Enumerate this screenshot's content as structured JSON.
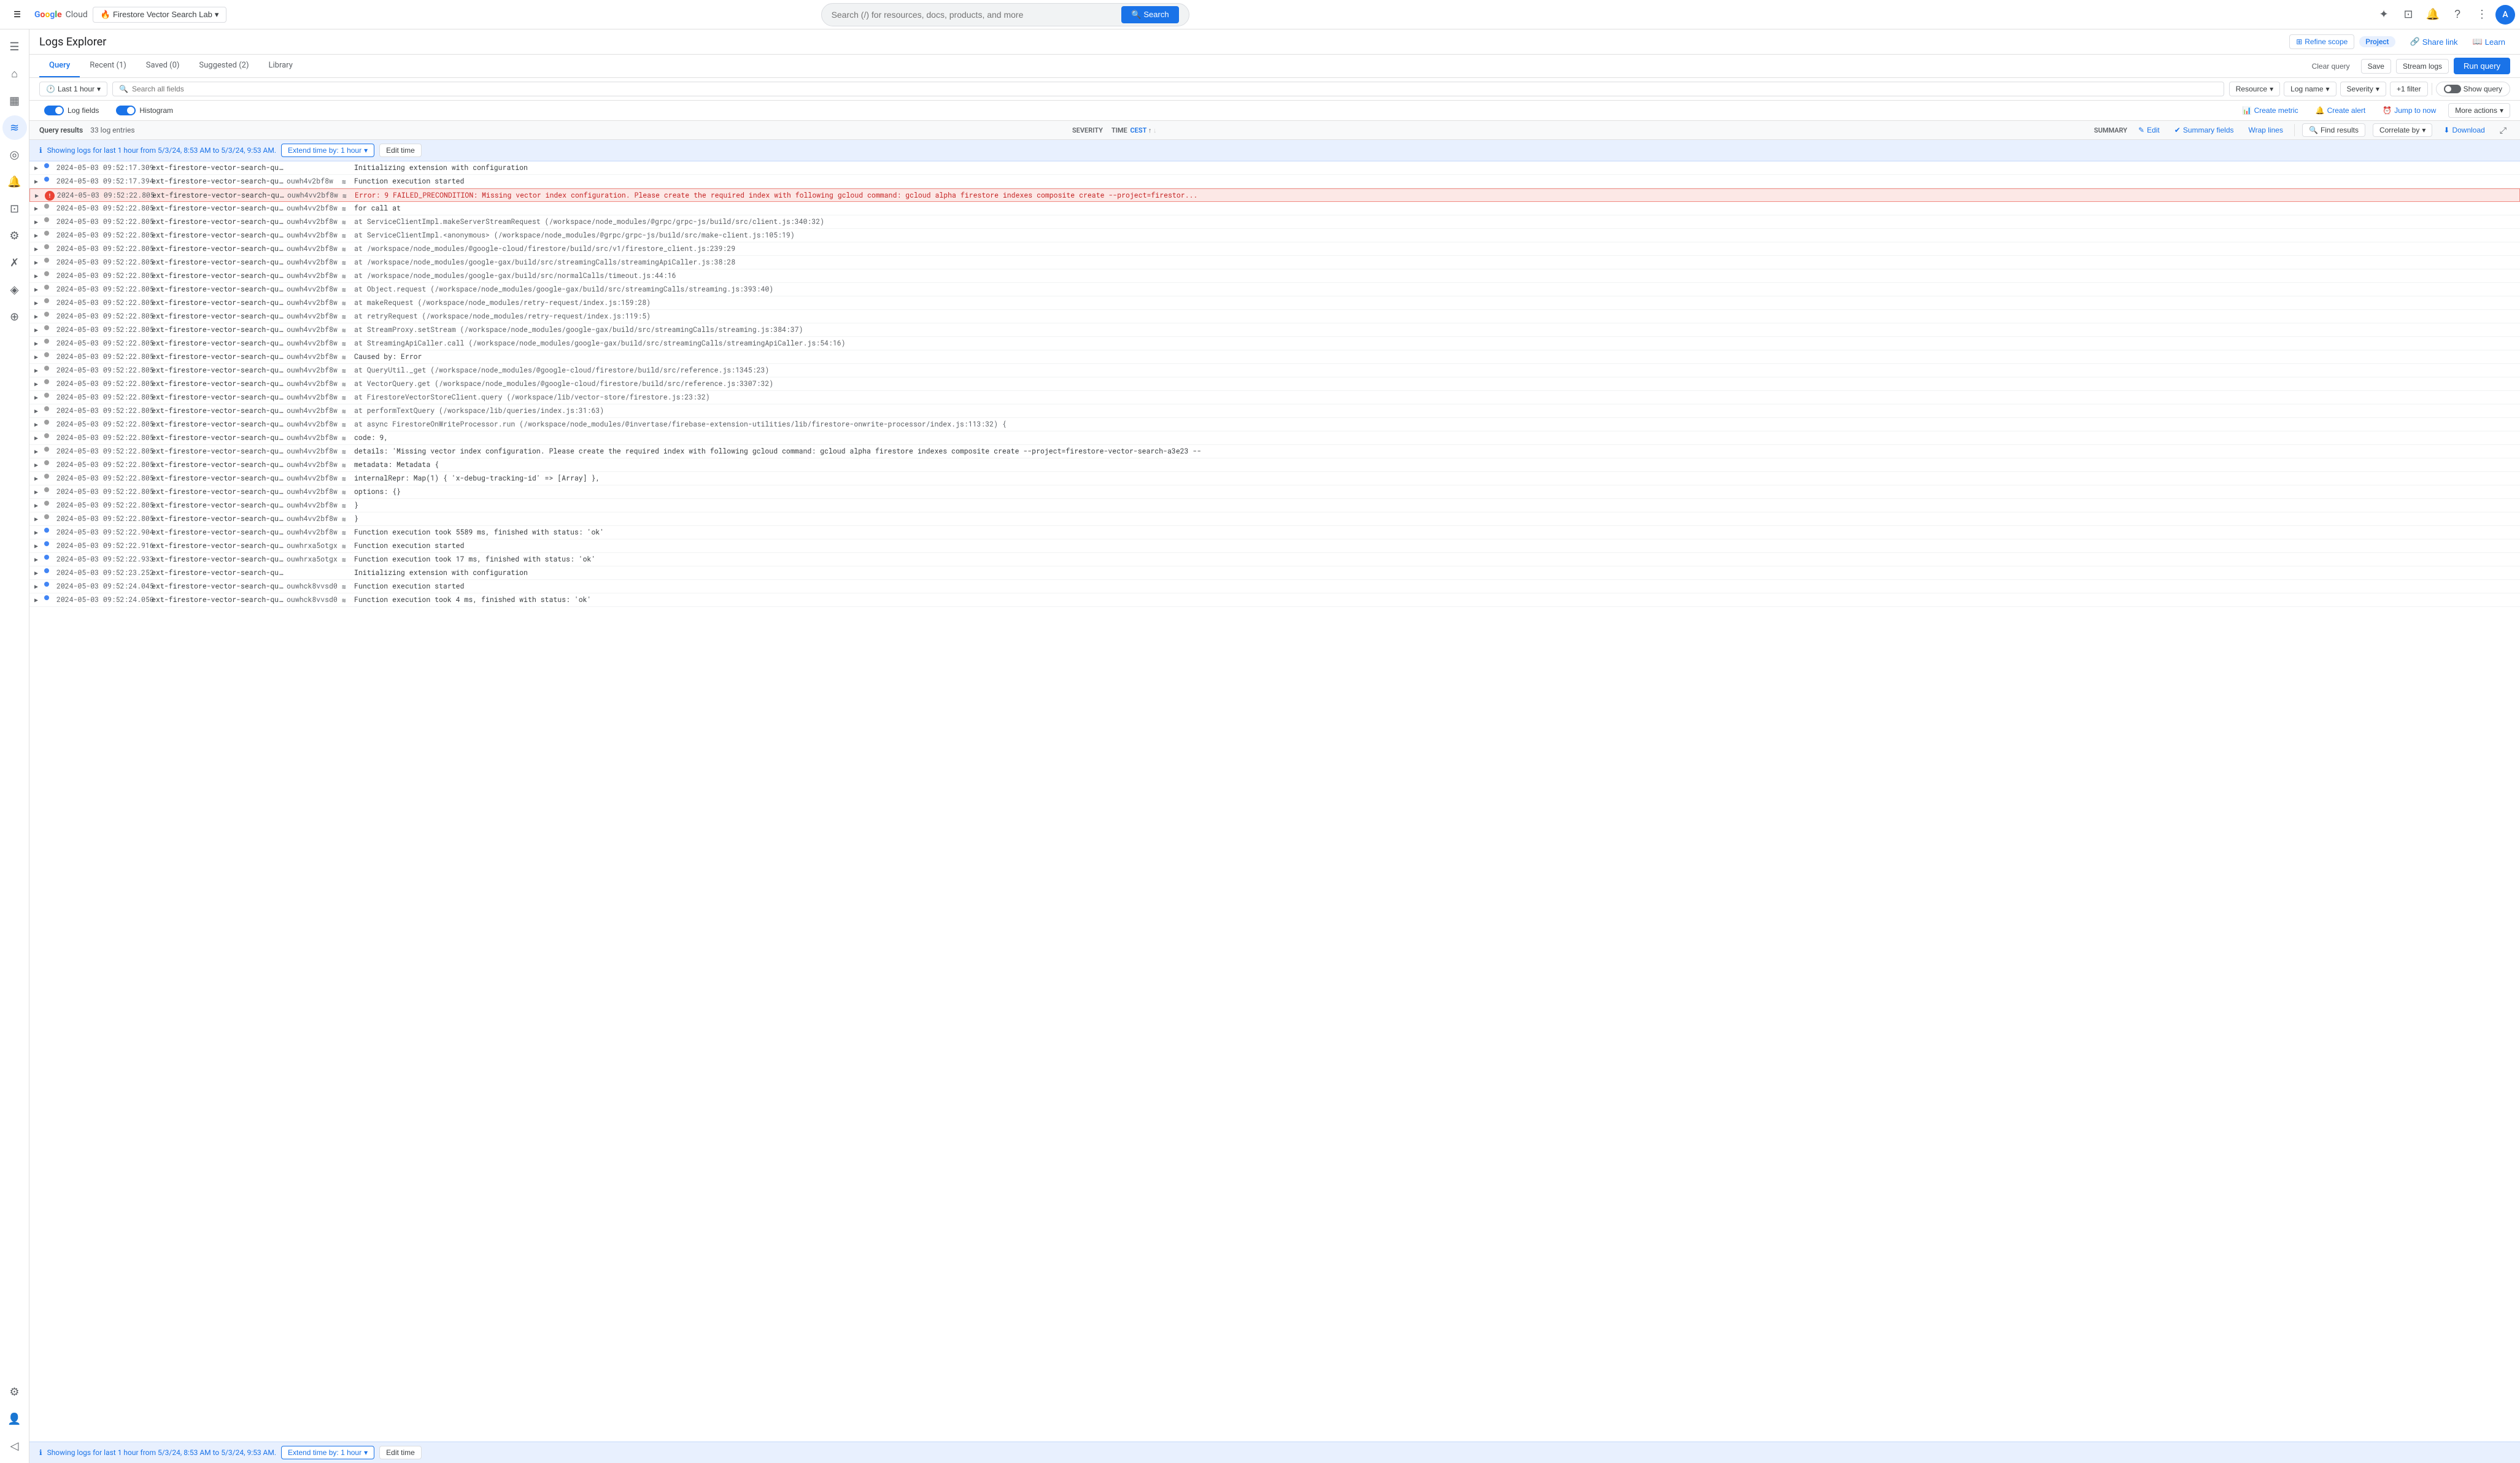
{
  "topNav": {
    "hamburger": "☰",
    "logoLetters": [
      "G",
      "o",
      "o",
      "g",
      "l",
      "e"
    ],
    "logoColors": [
      "#4285f4",
      "#ea4335",
      "#fbbc04",
      "#4285f4",
      "#34a853",
      "#ea4335"
    ],
    "cloudText": " Cloud",
    "projectSelector": "Firestore Vector Search Lab",
    "searchPlaceholder": "Search (/) for resources, docs, products, and more",
    "searchBtn": "Search",
    "navIcons": [
      "✦",
      "⊡",
      "🔔",
      "?",
      "⋮"
    ],
    "avatarInitial": "A"
  },
  "sidebar": {
    "icons": [
      "≡",
      "○",
      "▦",
      "≋",
      "◎",
      "🔔",
      "⊡",
      "⚙",
      "⚙",
      "👤"
    ]
  },
  "pageHeader": {
    "title": "Logs Explorer",
    "refineScopeLabel": "Refine scope",
    "projectBadge": "Project",
    "shareLink": "Share link",
    "learn": "Learn"
  },
  "tabs": {
    "items": [
      {
        "label": "Query",
        "active": true
      },
      {
        "label": "Recent (1)",
        "active": false
      },
      {
        "label": "Saved (0)",
        "active": false
      },
      {
        "label": "Suggested (2)",
        "active": false
      },
      {
        "label": "Library",
        "active": false
      }
    ],
    "clearQuery": "Clear query",
    "save": "Save",
    "streamLogs": "Stream logs",
    "runQuery": "Run query"
  },
  "queryToolbar": {
    "timeLabel": "Last 1 hour",
    "searchPlaceholder": "Search all fields",
    "resourceLabel": "Resource",
    "logNameLabel": "Log name",
    "severityLabel": "Severity",
    "plusFilter": "+1 filter",
    "showQuery": "Show query"
  },
  "logToolbar": {
    "logFieldsLabel": "Log fields",
    "histogramLabel": "Histogram",
    "createMetric": "Create metric",
    "createAlert": "Create alert",
    "jumpNow": "Jump to now",
    "moreActions": "More actions"
  },
  "resultsBar": {
    "count": "Query results",
    "entries": "33 log entries",
    "severityLabel": "SEVERITY",
    "timeLabel": "TIME",
    "timeSort": "CEST",
    "summaryLabel": "SUMMARY",
    "editLabel": "✎ Edit",
    "summaryFieldsLabel": "✔ Summary fields",
    "wrapLines": "Wrap lines",
    "findResults": "Find results",
    "correlateBy": "Correlate by",
    "download": "Download",
    "expand": "⤢"
  },
  "infoBanner": {
    "icon": "ℹ",
    "text": "Showing logs for last 1 hour from 5/3/24, 8:53 AM to 5/3/24, 9:53 AM.",
    "extendBtn": "Extend time by: 1 hour",
    "extendDropdown": "▾",
    "editTime": "Edit time"
  },
  "logEntries": [
    {
      "expand": "▶",
      "severity": "info",
      "time": "2024-05-03  09:52:17.309",
      "function": "ext-firestore-vector-search-queryOnWrite",
      "id": "",
      "hasIcon": false,
      "message": "Initializing extension with configuration"
    },
    {
      "expand": "▶",
      "severity": "info",
      "time": "2024-05-03  09:52:17.394",
      "function": "ext-firestore-vector-search-queryOnWrite",
      "id": "ouwh4v2bf8w",
      "hasIcon": true,
      "message": "Function execution started"
    },
    {
      "expand": "▶",
      "severity": "error",
      "time": "2024-05-03  09:52:22.805",
      "function": "ext-firestore-vector-search-queryOnWrite",
      "id": "ouwh4vv2bf8w",
      "hasIcon": true,
      "message": "Error: 9 FAILED_PRECONDITION: Missing vector index configuration. Please create the required index with following gcloud command: gcloud alpha firestore indexes composite create --project=firestor...",
      "isErrorHighlight": true
    },
    {
      "expand": "▶",
      "severity": "debug",
      "time": "2024-05-03  09:52:22.805",
      "function": "ext-firestore-vector-search-queryOnWrite",
      "id": "ouwh4vv2bf8w",
      "hasIcon": true,
      "message": "for call at"
    },
    {
      "expand": "▶",
      "severity": "debug",
      "time": "2024-05-03  09:52:22.805",
      "function": "ext-firestore-vector-search-queryOnWrite",
      "id": "ouwh4vv2bf8w",
      "hasIcon": true,
      "message": "    at ServiceClientImpl.makeServerStreamRequest (/workspace/node_modules/@grpc/grpc-js/build/src/client.js:340:32)"
    },
    {
      "expand": "▶",
      "severity": "debug",
      "time": "2024-05-03  09:52:22.805",
      "function": "ext-firestore-vector-search-queryOnWrite",
      "id": "ouwh4vv2bf8w",
      "hasIcon": true,
      "message": "    at ServiceClientImpl.<anonymous> (/workspace/node_modules/@grpc/grpc-js/build/src/make-client.js:105:19)"
    },
    {
      "expand": "▶",
      "severity": "debug",
      "time": "2024-05-03  09:52:22.805",
      "function": "ext-firestore-vector-search-queryOnWrite",
      "id": "ouwh4vv2bf8w",
      "hasIcon": true,
      "message": "    at /workspace/node_modules/@google-cloud/firestore/build/src/v1/firestore_client.js:239:29"
    },
    {
      "expand": "▶",
      "severity": "debug",
      "time": "2024-05-03  09:52:22.805",
      "function": "ext-firestore-vector-search-queryOnWrite",
      "id": "ouwh4vv2bf8w",
      "hasIcon": true,
      "message": "    at /workspace/node_modules/google-gax/build/src/streamingCalls/streamingApiCaller.js:38:28"
    },
    {
      "expand": "▶",
      "severity": "debug",
      "time": "2024-05-03  09:52:22.805",
      "function": "ext-firestore-vector-search-queryOnWrite",
      "id": "ouwh4vv2bf8w",
      "hasIcon": true,
      "message": "    at /workspace/node_modules/google-gax/build/src/normalCalls/timeout.js:44:16"
    },
    {
      "expand": "▶",
      "severity": "debug",
      "time": "2024-05-03  09:52:22.805",
      "function": "ext-firestore-vector-search-queryOnWrite",
      "id": "ouwh4vv2bf8w",
      "hasIcon": true,
      "message": "    at Object.request (/workspace/node_modules/google-gax/build/src/streamingCalls/streaming.js:393:40)"
    },
    {
      "expand": "▶",
      "severity": "debug",
      "time": "2024-05-03  09:52:22.805",
      "function": "ext-firestore-vector-search-queryOnWrite",
      "id": "ouwh4vv2bf8w",
      "hasIcon": true,
      "message": "    at makeRequest (/workspace/node_modules/retry-request/index.js:159:28)"
    },
    {
      "expand": "▶",
      "severity": "debug",
      "time": "2024-05-03  09:52:22.805",
      "function": "ext-firestore-vector-search-queryOnWrite",
      "id": "ouwh4vv2bf8w",
      "hasIcon": true,
      "message": "    at retryRequest (/workspace/node_modules/retry-request/index.js:119:5)"
    },
    {
      "expand": "▶",
      "severity": "debug",
      "time": "2024-05-03  09:52:22.805",
      "function": "ext-firestore-vector-search-queryOnWrite",
      "id": "ouwh4vv2bf8w",
      "hasIcon": true,
      "message": "    at StreamProxy.setStream (/workspace/node_modules/google-gax/build/src/streamingCalls/streaming.js:384:37)"
    },
    {
      "expand": "▶",
      "severity": "debug",
      "time": "2024-05-03  09:52:22.805",
      "function": "ext-firestore-vector-search-queryOnWrite",
      "id": "ouwh4vv2bf8w",
      "hasIcon": true,
      "message": "    at StreamingApiCaller.call (/workspace/node_modules/google-gax/build/src/streamingCalls/streamingApiCaller.js:54:16)"
    },
    {
      "expand": "▶",
      "severity": "debug",
      "time": "2024-05-03  09:52:22.805",
      "function": "ext-firestore-vector-search-queryOnWrite",
      "id": "ouwh4vv2bf8w",
      "hasIcon": true,
      "message": "Caused by: Error"
    },
    {
      "expand": "▶",
      "severity": "debug",
      "time": "2024-05-03  09:52:22.805",
      "function": "ext-firestore-vector-search-queryOnWrite",
      "id": "ouwh4vv2bf8w",
      "hasIcon": true,
      "message": "    at QueryUtil._get (/workspace/node_modules/@google-cloud/firestore/build/src/reference.js:1345:23)"
    },
    {
      "expand": "▶",
      "severity": "debug",
      "time": "2024-05-03  09:52:22.805",
      "function": "ext-firestore-vector-search-queryOnWrite",
      "id": "ouwh4vv2bf8w",
      "hasIcon": true,
      "message": "    at VectorQuery.get (/workspace/node_modules/@google-cloud/firestore/build/src/reference.js:3307:32)"
    },
    {
      "expand": "▶",
      "severity": "debug",
      "time": "2024-05-03  09:52:22.805",
      "function": "ext-firestore-vector-search-queryOnWrite",
      "id": "ouwh4vv2bf8w",
      "hasIcon": true,
      "message": "    at FirestoreVectorStoreClient.query (/workspace/lib/vector-store/firestore.js:23:32)"
    },
    {
      "expand": "▶",
      "severity": "debug",
      "time": "2024-05-03  09:52:22.805",
      "function": "ext-firestore-vector-search-queryOnWrite",
      "id": "ouwh4vv2bf8w",
      "hasIcon": true,
      "message": "    at performTextQuery (/workspace/lib/queries/index.js:31:63)"
    },
    {
      "expand": "▶",
      "severity": "debug",
      "time": "2024-05-03  09:52:22.805",
      "function": "ext-firestore-vector-search-queryOnWrite",
      "id": "ouwh4vv2bf8w",
      "hasIcon": true,
      "message": "    at async FirestoreOnWriteProcessor.run (/workspace/node_modules/@invertase/firebase-extension-utilities/lib/firestore-onwrite-processor/index.js:113:32) {"
    },
    {
      "expand": "▶",
      "severity": "debug",
      "time": "2024-05-03  09:52:22.805",
      "function": "ext-firestore-vector-search-queryOnWrite",
      "id": "ouwh4vv2bf8w",
      "hasIcon": true,
      "message": "code: 9,"
    },
    {
      "expand": "▶",
      "severity": "debug",
      "time": "2024-05-03  09:52:22.805",
      "function": "ext-firestore-vector-search-queryOnWrite",
      "id": "ouwh4vv2bf8w",
      "hasIcon": true,
      "message": "details: 'Missing vector index configuration. Please create the required index with following gcloud command: gcloud alpha firestore indexes composite create --project=firestore-vector-search-a3e23 --"
    },
    {
      "expand": "▶",
      "severity": "debug",
      "time": "2024-05-03  09:52:22.805",
      "function": "ext-firestore-vector-search-queryOnWrite",
      "id": "ouwh4vv2bf8w",
      "hasIcon": true,
      "message": "metadata: Metadata {"
    },
    {
      "expand": "▶",
      "severity": "debug",
      "time": "2024-05-03  09:52:22.805",
      "function": "ext-firestore-vector-search-queryOnWrite",
      "id": "ouwh4vv2bf8w",
      "hasIcon": true,
      "message": "    internalRepr: Map(1) { 'x-debug-tracking-id' => [Array] },"
    },
    {
      "expand": "▶",
      "severity": "debug",
      "time": "2024-05-03  09:52:22.805",
      "function": "ext-firestore-vector-search-queryOnWrite",
      "id": "ouwh4vv2bf8w",
      "hasIcon": true,
      "message": "    options: {}"
    },
    {
      "expand": "▶",
      "severity": "debug",
      "time": "2024-05-03  09:52:22.805",
      "function": "ext-firestore-vector-search-queryOnWrite",
      "id": "ouwh4vv2bf8w",
      "hasIcon": true,
      "message": "}"
    },
    {
      "expand": "▶",
      "severity": "debug",
      "time": "2024-05-03  09:52:22.805",
      "function": "ext-firestore-vector-search-queryOnWrite",
      "id": "ouwh4vv2bf8w",
      "hasIcon": true,
      "message": "}"
    },
    {
      "expand": "▶",
      "severity": "info",
      "time": "2024-05-03  09:52:22.904",
      "function": "ext-firestore-vector-search-queryOnWrite",
      "id": "ouwh4vv2bf8w",
      "hasIcon": true,
      "message": "Function execution took 5589 ms, finished with status: 'ok'"
    },
    {
      "expand": "▶",
      "severity": "info",
      "time": "2024-05-03  09:52:22.916",
      "function": "ext-firestore-vector-search-queryOnWrite",
      "id": "ouwhrxa5otgx",
      "hasIcon": true,
      "message": "Function execution started"
    },
    {
      "expand": "▶",
      "severity": "info",
      "time": "2024-05-03  09:52:22.933",
      "function": "ext-firestore-vector-search-queryOnWrite",
      "id": "ouwhrxa5otgx",
      "hasIcon": true,
      "message": "Function execution took 17 ms, finished with status: 'ok'"
    },
    {
      "expand": "▶",
      "severity": "info",
      "time": "2024-05-03  09:52:23.252",
      "function": "ext-firestore-vector-search-queryOnWrite",
      "id": "",
      "hasIcon": false,
      "message": "Initializing extension with configuration"
    },
    {
      "expand": "▶",
      "severity": "info",
      "time": "2024-05-03  09:52:24.045",
      "function": "ext-firestore-vector-search-queryOnWrite",
      "id": "ouwhck8vvsd0",
      "hasIcon": true,
      "message": "Function execution started"
    },
    {
      "expand": "▶",
      "severity": "info",
      "time": "2024-05-03  09:52:24.050",
      "function": "ext-firestore-vector-search-queryOnWrite",
      "id": "ouwhck8vvsd0",
      "hasIcon": true,
      "message": "Function execution took 4 ms, finished with status: 'ok'"
    }
  ],
  "bottomBanner": {
    "icon": "ℹ",
    "text": "Showing logs for last 1 hour from 5/3/24, 8:53 AM to 5/3/24, 9:53 AM.",
    "extendBtn": "Extend time by: 1 hour",
    "editTime": "Edit time"
  }
}
